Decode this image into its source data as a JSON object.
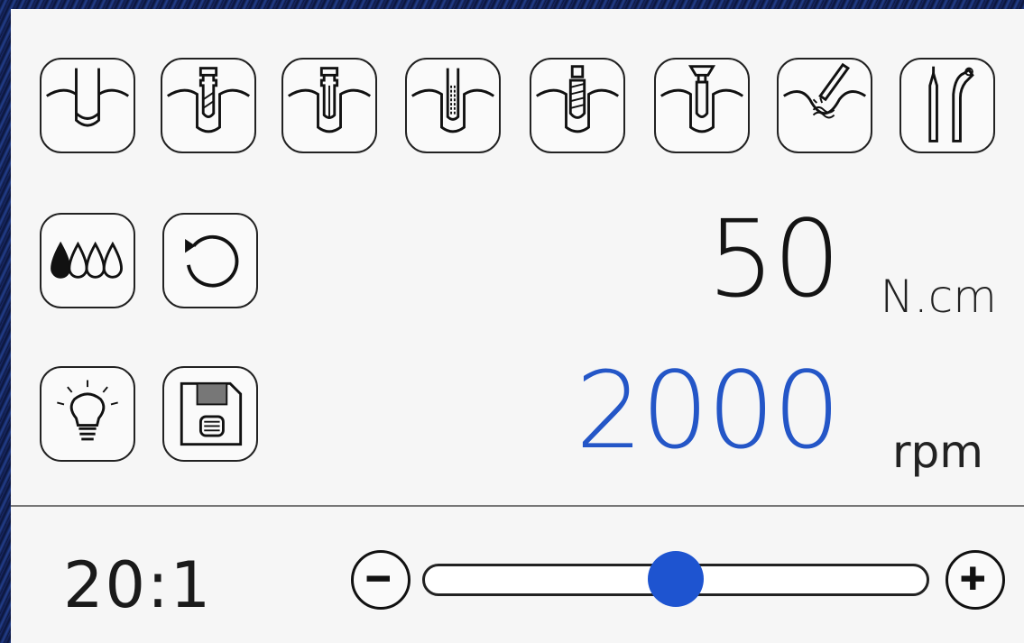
{
  "modes": [
    {
      "icon": "tooth-preparation-icon"
    },
    {
      "icon": "pilot-drill-icon"
    },
    {
      "icon": "twist-drill-icon"
    },
    {
      "icon": "bone-tap-icon"
    },
    {
      "icon": "implant-placement-icon"
    },
    {
      "icon": "cover-screw-icon"
    },
    {
      "icon": "irrigation-icon"
    },
    {
      "icon": "handpiece-icon"
    }
  ],
  "controls": {
    "irrigation_icon": "water-drops-icon",
    "rotation_icon": "rotation-direction-icon",
    "light_icon": "light-bulb-icon",
    "save_icon": "save-icon"
  },
  "torque": {
    "value": "50",
    "unit": "N.cm"
  },
  "speed": {
    "value": "2000",
    "unit": "rpm"
  },
  "gear_ratio": "20:1",
  "speed_slider": {
    "level": 0.5
  },
  "colors": {
    "speed_value": "#2456c7",
    "slider_thumb": "#1e54d0"
  }
}
